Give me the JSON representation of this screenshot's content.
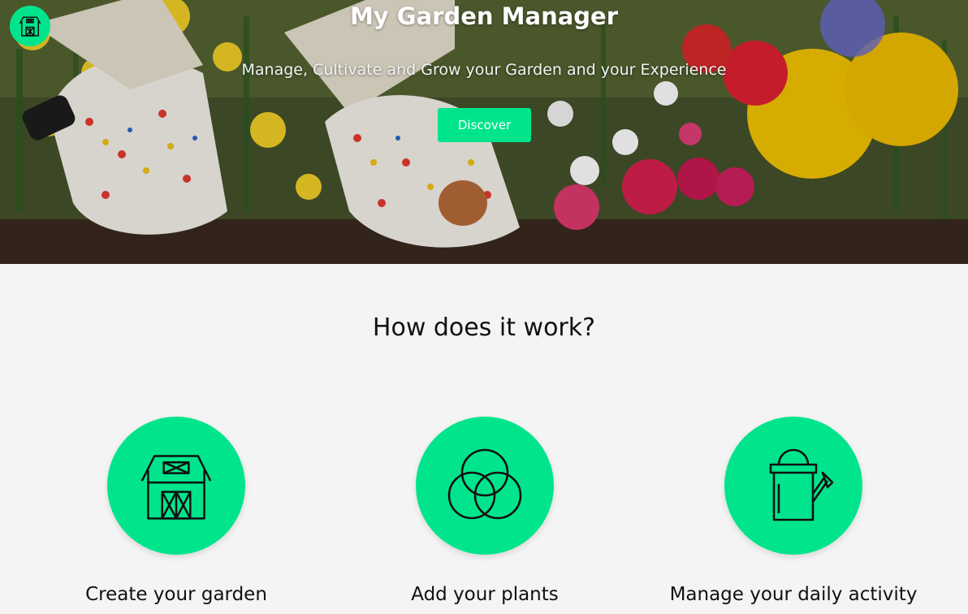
{
  "hero": {
    "title": "My Garden Manager",
    "subtitle": "Manage, Cultivate and Grow your Garden and your Experience",
    "cta_label": "Discover"
  },
  "logo": {
    "icon": "barn-icon"
  },
  "how": {
    "title": "How does it work?",
    "steps": [
      {
        "label": "Create your garden",
        "icon": "barn-icon"
      },
      {
        "label": "Add your plants",
        "icon": "venn-circles-icon"
      },
      {
        "label": "Manage your daily activity",
        "icon": "watering-can-icon"
      }
    ]
  },
  "colors": {
    "accent": "#00e58b",
    "background": "#f4f4f4",
    "text": "#111111"
  }
}
